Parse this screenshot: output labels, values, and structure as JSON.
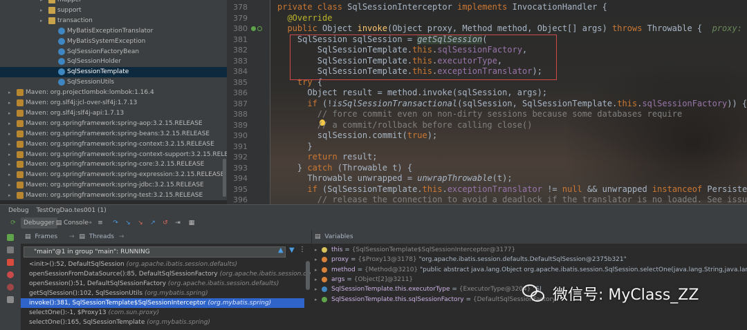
{
  "project_tree": {
    "rows": [
      {
        "label": "mapper",
        "kind": "folder",
        "indent": 1,
        "arrow": "▸"
      },
      {
        "label": "support",
        "kind": "folder",
        "indent": 1,
        "arrow": "▸"
      },
      {
        "label": "transaction",
        "kind": "folder",
        "indent": 1,
        "arrow": "▸"
      },
      {
        "label": "MyBatisExceptionTranslator",
        "kind": "class",
        "indent": 2,
        "arrow": ""
      },
      {
        "label": "MyBatisSystemException",
        "kind": "class",
        "indent": 2,
        "arrow": ""
      },
      {
        "label": "SqlSessionFactoryBean",
        "kind": "class",
        "indent": 2,
        "arrow": ""
      },
      {
        "label": "SqlSessionHolder",
        "kind": "class",
        "indent": 2,
        "arrow": ""
      },
      {
        "label": "SqlSessionTemplate",
        "kind": "class",
        "indent": 2,
        "arrow": "",
        "selected": true
      },
      {
        "label": "SqlSessionUtils",
        "kind": "class",
        "indent": 2,
        "arrow": ""
      },
      {
        "label": "Maven: org.projectlombok:lombok:1.16.4",
        "kind": "jar",
        "indent": 0,
        "arrow": "▸"
      },
      {
        "label": "Maven: org.slf4j:jcl-over-slf4j:1.7.13",
        "kind": "jar",
        "indent": 0,
        "arrow": "▸"
      },
      {
        "label": "Maven: org.slf4j:slf4j-api:1.7.13",
        "kind": "jar",
        "indent": 0,
        "arrow": "▸"
      },
      {
        "label": "Maven: org.springframework:spring-aop:3.2.15.RELEASE",
        "kind": "jar",
        "indent": 0,
        "arrow": "▸"
      },
      {
        "label": "Maven: org.springframework:spring-beans:3.2.15.RELEASE",
        "kind": "jar",
        "indent": 0,
        "arrow": "▸"
      },
      {
        "label": "Maven: org.springframework:spring-context:3.2.15.RELEASE",
        "kind": "jar",
        "indent": 0,
        "arrow": "▸"
      },
      {
        "label": "Maven: org.springframework:spring-context-support:3.2.15.RELEA",
        "kind": "jar",
        "indent": 0,
        "arrow": "▸"
      },
      {
        "label": "Maven: org.springframework:spring-core:3.2.15.RELEASE",
        "kind": "jar",
        "indent": 0,
        "arrow": "▸"
      },
      {
        "label": "Maven: org.springframework:spring-expression:3.2.15.RELEASE",
        "kind": "jar",
        "indent": 0,
        "arrow": "▸"
      },
      {
        "label": "Maven: org.springframework:spring-jdbc:3.2.15.RELEASE",
        "kind": "jar",
        "indent": 0,
        "arrow": "▸"
      },
      {
        "label": "Maven: org.springframework:spring-test:3.2.15.RELEASE",
        "kind": "jar",
        "indent": 0,
        "arrow": "▸"
      }
    ]
  },
  "editor": {
    "line_numbers": [
      "378",
      "379",
      "380",
      "381",
      "382",
      "383",
      "384",
      "385",
      "386",
      "387",
      "388",
      "389",
      "390",
      "391",
      "392",
      "393",
      "394",
      "395",
      "396"
    ],
    "lines": [
      [
        {
          "t": "private class ",
          "c": "kw"
        },
        {
          "t": "SqlSessionInterceptor "
        },
        {
          "t": "implements ",
          "c": "kw"
        },
        {
          "t": "InvocationHandler {"
        }
      ],
      [
        {
          "t": "  "
        },
        {
          "t": "@Override",
          "c": "ann"
        }
      ],
      [
        {
          "t": "  "
        },
        {
          "t": "public ",
          "c": "kw"
        },
        {
          "t": "Object "
        },
        {
          "t": "invoke",
          "c": "fn"
        },
        {
          "t": "(Object proxy, Method method, Object[] args) "
        },
        {
          "t": "throws ",
          "c": "kw"
        },
        {
          "t": "Throwable {  "
        },
        {
          "t": "proxy: \"",
          "c": "hint"
        }
      ],
      [
        {
          "t": "    SqlSession sqlSession = "
        },
        {
          "t": "getSqlSession",
          "c": "it hl"
        },
        {
          "t": "("
        }
      ],
      [
        {
          "t": "        SqlSessionTemplate."
        },
        {
          "t": "this",
          "c": "kw"
        },
        {
          "t": "."
        },
        {
          "t": "sqlSessionFactory",
          "c": "fld"
        },
        {
          "t": ","
        }
      ],
      [
        {
          "t": "        SqlSessionTemplate."
        },
        {
          "t": "this",
          "c": "kw"
        },
        {
          "t": "."
        },
        {
          "t": "executorType",
          "c": "fld"
        },
        {
          "t": ","
        }
      ],
      [
        {
          "t": "        SqlSessionTemplate."
        },
        {
          "t": "this",
          "c": "kw"
        },
        {
          "t": "."
        },
        {
          "t": "exceptionTranslator",
          "c": "fld"
        },
        {
          "t": ");"
        }
      ],
      [
        {
          "t": "    "
        },
        {
          "t": "try ",
          "c": "kw"
        },
        {
          "t": "{"
        }
      ],
      [
        {
          "t": "      Object result = method.invoke(sqlSession, args);"
        }
      ],
      [
        {
          "t": "      "
        },
        {
          "t": "if ",
          "c": "kw"
        },
        {
          "t": "(!"
        },
        {
          "t": "isSqlSessionTransactional",
          "c": "it"
        },
        {
          "t": "(sqlSession, SqlSessionTemplate."
        },
        {
          "t": "this",
          "c": "kw"
        },
        {
          "t": "."
        },
        {
          "t": "sqlSessionFactory",
          "c": "fld"
        },
        {
          "t": ")) {"
        }
      ],
      [
        {
          "t": "        "
        },
        {
          "t": "// force commit even on non-dirty sessions because some databases require",
          "c": "cm"
        }
      ],
      [
        {
          "t": "        "
        },
        {
          "t": "// a commit/rollback before calling close()",
          "c": "cm"
        }
      ],
      [
        {
          "t": "        sqlSession.commit("
        },
        {
          "t": "true",
          "c": "kw"
        },
        {
          "t": ");"
        }
      ],
      [
        {
          "t": "      }"
        }
      ],
      [
        {
          "t": "      "
        },
        {
          "t": "return ",
          "c": "kw"
        },
        {
          "t": "result;"
        }
      ],
      [
        {
          "t": "    } "
        },
        {
          "t": "catch ",
          "c": "kw"
        },
        {
          "t": "(Throwable t) {"
        }
      ],
      [
        {
          "t": "      Throwable unwrapped = "
        },
        {
          "t": "unwrapThrowable",
          "c": "it"
        },
        {
          "t": "(t);"
        }
      ],
      [
        {
          "t": "      "
        },
        {
          "t": "if ",
          "c": "kw"
        },
        {
          "t": "(SqlSessionTemplate."
        },
        {
          "t": "this",
          "c": "kw"
        },
        {
          "t": "."
        },
        {
          "t": "exceptionTranslator",
          "c": "fld"
        },
        {
          "t": " != "
        },
        {
          "t": "null ",
          "c": "kw"
        },
        {
          "t": "&& unwrapped "
        },
        {
          "t": "instanceof ",
          "c": "kw"
        },
        {
          "t": "Persisten"
        }
      ],
      [
        {
          "t": "        "
        },
        {
          "t": "// release the connection to avoid a deadlock if the translator is no loaded. See issue",
          "c": "cm"
        }
      ]
    ]
  },
  "debug": {
    "title": "Debug",
    "config": "TestOrgDao.tes001 (1)",
    "tab_debugger": "Debugger",
    "tab_console": "Console",
    "frames_label": "Frames",
    "threads_label": "Threads",
    "variables_label": "Variables",
    "thread_selected": "\"main\"@1 in group \"main\": RUNNING",
    "frames": [
      {
        "method": "<init>():52, DefaultSqlSession",
        "pkg": "(org.apache.ibatis.session.defaults)"
      },
      {
        "method": "openSessionFromDataSource():85, DefaultSqlSessionFactory",
        "pkg": "(org.apache.ibatis.session.defaults)"
      },
      {
        "method": "openSession():51, DefaultSqlSessionFactory",
        "pkg": "(org.apache.ibatis.session.defaults)"
      },
      {
        "method": "getSqlSession():102, SqlSessionUtils",
        "pkg": "(org.mybatis.spring)"
      },
      {
        "method": "invoke():381, SqlSessionTemplate$SqlSessionInterceptor",
        "pkg": "(org.mybatis.spring)",
        "selected": true
      },
      {
        "method": "selectOne():-1, $Proxy13",
        "pkg": "(com.sun.proxy)"
      },
      {
        "method": "selectOne():165, SqlSessionTemplate",
        "pkg": "(org.mybatis.spring)"
      }
    ],
    "variables": [
      {
        "name": "this",
        "rest": " = ",
        "type": "{SqlSessionTemplate$SqlSessionInterceptor@3177}",
        "val": "",
        "icon": "#d8c25a",
        "toggle": "▸"
      },
      {
        "name": "proxy",
        "rest": " = ",
        "type": "{$Proxy13@3178}",
        "val": " \"org.apache.ibatis.session.defaults.DefaultSqlSession@2375b321\"",
        "icon": "#d9833a",
        "toggle": "▸"
      },
      {
        "name": "method",
        "rest": " = ",
        "type": "{Method@3210}",
        "val": " \"public abstract java.lang.Object org.apache.ibatis.session.SqlSession.selectOne(java.lang.String,java.lang.Object)\"",
        "icon": "#d9833a",
        "toggle": "▸"
      },
      {
        "name": "args",
        "rest": " = ",
        "type": "{Object[2]@3211}",
        "val": "",
        "icon": "#d9833a",
        "toggle": "▸"
      },
      {
        "name": "SqlSessionTemplate.this.executorType",
        "rest": " = ",
        "type": "{ExecutorType@3204}",
        "val": " \"SI",
        "icon": "#3f87c2",
        "toggle": "▸"
      },
      {
        "name": "SqlSessionTemplate.this.sqlSessionFactory",
        "rest": " = ",
        "type": "{DefaultSqlSessionFactory",
        "val": "",
        "icon": "#5fa34a",
        "toggle": "▸"
      }
    ]
  },
  "watermark": {
    "text": "微信号: MyClass_ZZ"
  },
  "colors": {
    "accent_selection": "#2f65ca",
    "tree_selection": "#0d293e",
    "highlight_box": "#d04a4a"
  }
}
